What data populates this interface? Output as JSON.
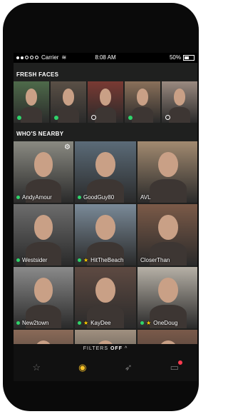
{
  "status_bar": {
    "carrier": "Carrier",
    "time": "8:08 AM",
    "battery_percent": "50%",
    "battery_level": 0.5
  },
  "fresh_faces": {
    "title": "FRESH FACES",
    "items": [
      {
        "status": "online",
        "bg": "#4e6a4a"
      },
      {
        "status": "online",
        "bg": "#5a5046"
      },
      {
        "status": "offline",
        "bg": "#7a3a33"
      },
      {
        "status": "online",
        "bg": "#8a705a"
      },
      {
        "status": "offline",
        "bg": "#9a8a80"
      }
    ]
  },
  "nearby": {
    "title": "WHO'S NEARBY",
    "items": [
      {
        "name": "AndyAmour",
        "status": "online",
        "favorite": false,
        "settings": true,
        "bg": "#8a8a82"
      },
      {
        "name": "GoodGuy80",
        "status": "online",
        "favorite": false,
        "settings": false,
        "bg": "#5b6b78"
      },
      {
        "name": "AVL",
        "status": "none",
        "favorite": false,
        "settings": false,
        "bg": "#a28a70"
      },
      {
        "name": "Westsider",
        "status": "online",
        "favorite": false,
        "settings": false,
        "bg": "#6c6c6c"
      },
      {
        "name": "HitTheBeach",
        "status": "online",
        "favorite": true,
        "settings": false,
        "bg": "#7a8a98"
      },
      {
        "name": "CloserThan",
        "status": "none",
        "favorite": false,
        "settings": false,
        "bg": "#7b5a48"
      },
      {
        "name": "New2town",
        "status": "online",
        "favorite": false,
        "settings": false,
        "bg": "#8a8a8a"
      },
      {
        "name": "KayDee",
        "status": "online",
        "favorite": true,
        "settings": false,
        "bg": "#5e4a42"
      },
      {
        "name": "OneDoug",
        "status": "online",
        "favorite": true,
        "settings": false,
        "bg": "#b6b0a6"
      }
    ]
  },
  "filters": {
    "label": "FILTERS",
    "state": "OFF",
    "chevron": "^"
  },
  "tab_bar": {
    "items": [
      {
        "icon": "star-icon",
        "glyph": "☆",
        "active": false
      },
      {
        "icon": "grindr-mask-icon",
        "glyph": "◉",
        "active": true
      },
      {
        "icon": "rocket-icon",
        "glyph": "➶",
        "active": false
      },
      {
        "icon": "chat-icon",
        "glyph": "▭",
        "active": false,
        "badge": true
      }
    ]
  },
  "colors": {
    "online": "#2fd46b",
    "favorite": "#ffcc00",
    "active_tab": "#f6c027",
    "badge": "#ff3b4f"
  }
}
